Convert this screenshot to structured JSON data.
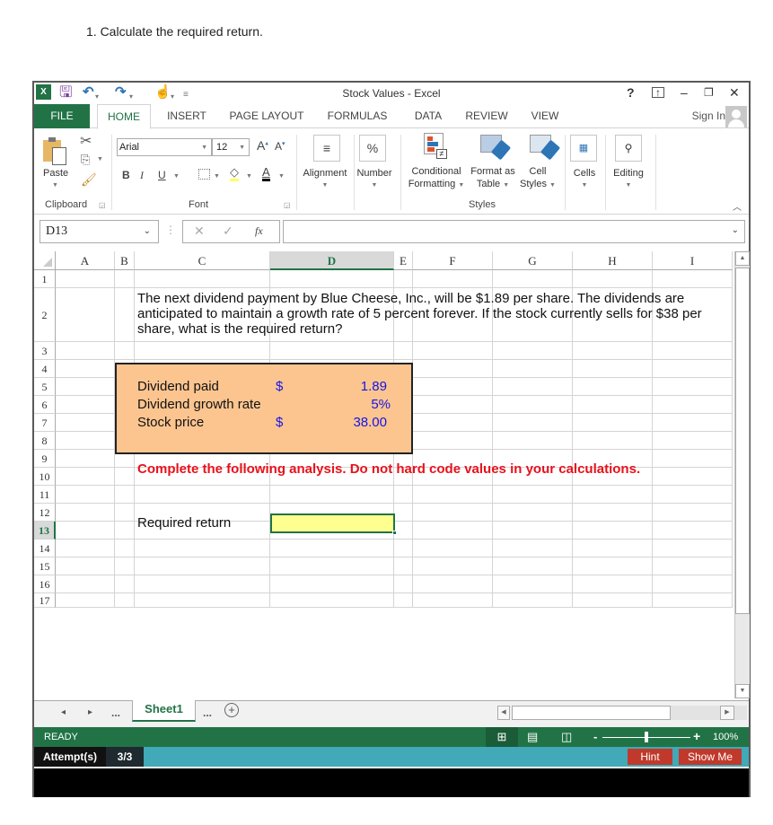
{
  "question": "1.  Calculate the required return.",
  "window": {
    "title": "Stock Values - Excel",
    "controls": {
      "help": "?",
      "ribbon_display": "⤒",
      "minimize": "–",
      "restore": "🗗",
      "close": "✕"
    }
  },
  "quick_access": {
    "icons": [
      "excel-logo-icon",
      "save-icon",
      "undo-icon",
      "redo-icon",
      "touch-mode-icon",
      "customize-icon"
    ]
  },
  "tabs": [
    {
      "label": "FILE"
    },
    {
      "label": "HOME",
      "active": true
    },
    {
      "label": "INSERT"
    },
    {
      "label": "PAGE LAYOUT"
    },
    {
      "label": "FORMULAS"
    },
    {
      "label": "DATA"
    },
    {
      "label": "REVIEW"
    },
    {
      "label": "VIEW"
    }
  ],
  "sign_in": "Sign In",
  "ribbon": {
    "clipboard": {
      "label": "Clipboard",
      "paste": "Paste"
    },
    "font": {
      "label": "Font",
      "name": "Arial",
      "size": "12",
      "bold": "B",
      "italic": "I",
      "underline": "U",
      "font_color_glyph": "A"
    },
    "alignment": {
      "label": "Alignment"
    },
    "number": {
      "label": "Number",
      "glyph": "%"
    },
    "styles": {
      "label": "Styles",
      "conditional_formatting": [
        "Conditional",
        "Formatting"
      ],
      "format_as_table": [
        "Format as",
        "Table"
      ],
      "cell_styles": [
        "Cell",
        "Styles"
      ]
    },
    "cells": {
      "label": "Cells"
    },
    "editing": {
      "label": "Editing"
    }
  },
  "formula_bar": {
    "name_box": "D13",
    "fx": "fx",
    "formula": ""
  },
  "columns": [
    "A",
    "B",
    "C",
    "D",
    "E",
    "F",
    "G",
    "H",
    "I"
  ],
  "selected_column": "D",
  "rows": [
    "1",
    "2",
    "3",
    "4",
    "5",
    "6",
    "7",
    "8",
    "9",
    "10",
    "11",
    "12",
    "13",
    "14",
    "15",
    "16",
    "17"
  ],
  "selected_row": "13",
  "sheet": {
    "problem_text": "The next dividend payment by Blue Cheese, Inc., will be $1.89 per share. The dividends are anticipated to maintain a growth rate of 5 percent forever. If the stock currently sells for $38 per share, what is the required return?",
    "inputs": [
      {
        "label": "Dividend paid",
        "currency": "$",
        "value": "1.89"
      },
      {
        "label": "Dividend growth rate",
        "currency": "",
        "value": "5%"
      },
      {
        "label": "Stock price",
        "currency": "$",
        "value": "38.00"
      }
    ],
    "instruction": "Complete the following analysis. Do not hard code values in your calculations.",
    "output_label": "Required return",
    "output_value": ""
  },
  "sheet_tabs": {
    "prev": "◂",
    "next": "▸",
    "ellipsis": "...",
    "active": "Sheet1",
    "add": "+"
  },
  "status": {
    "state": "READY",
    "zoom": "100%",
    "zoom_minus": "-",
    "zoom_plus": "+",
    "zoom_level": 0.5
  },
  "attempts": {
    "label": "Attempt(s)",
    "value": "3/3",
    "hint": "Hint",
    "show_me": "Show Me"
  },
  "colors": {
    "excel_green": "#217346",
    "input_fill": "#fcc590",
    "output_fill": "#ffff8f",
    "input_value_blue": "#1414e6",
    "warning_red": "#e8111b",
    "teal_bar": "#41a9b8",
    "button_red": "#c0392b"
  }
}
